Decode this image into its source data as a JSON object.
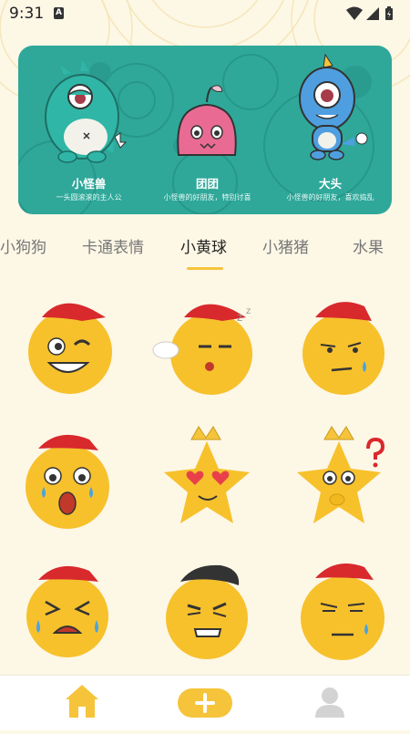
{
  "status_bar": {
    "time": "9:31",
    "notification_badge": "A",
    "icons": [
      "wifi-icon",
      "signal-icon",
      "battery-icon"
    ]
  },
  "banner": {
    "characters": [
      {
        "name": "小怪兽",
        "description": "一头圆滚滚的主人公",
        "color": "#2fb6a6",
        "icon": "green-monster"
      },
      {
        "name": "团团",
        "description": "小怪兽的好朋友，特别讨喜",
        "color": "#e96b93",
        "icon": "pink-blob"
      },
      {
        "name": "大头",
        "description": "小怪兽的好朋友，喜欢捣乱",
        "color": "#4f9fe0",
        "icon": "blue-monster"
      }
    ]
  },
  "tabs": [
    {
      "label": "小狗狗",
      "active": false
    },
    {
      "label": "卡通表情",
      "active": false
    },
    {
      "label": "小黄球",
      "active": true
    },
    {
      "label": "小猪猪",
      "active": false
    },
    {
      "label": "水果",
      "active": false
    }
  ],
  "stickers": [
    {
      "name": "winking-emoji",
      "shape": "ball",
      "hat": "red-cap"
    },
    {
      "name": "sleepy-emoji",
      "shape": "ball",
      "hat": "red-cap",
      "extra": "zzz"
    },
    {
      "name": "worried-emoji",
      "shape": "ball",
      "hat": "red-cap"
    },
    {
      "name": "shocked-crying-emoji",
      "shape": "ball",
      "hat": "red-cap"
    },
    {
      "name": "heart-eyes-star",
      "shape": "star",
      "hat": "crown"
    },
    {
      "name": "thinking-star",
      "shape": "star",
      "hat": "crown",
      "extra": "question-mark"
    },
    {
      "name": "crying-emoji",
      "shape": "ball",
      "hat": "red-cap"
    },
    {
      "name": "smirking-emoji",
      "shape": "ball",
      "hat": "black-cap"
    },
    {
      "name": "unamused-emoji",
      "shape": "ball",
      "hat": "red-cap"
    }
  ],
  "bottom_nav": {
    "items": [
      {
        "name": "home",
        "icon": "home-icon",
        "color": "#f6c43b",
        "active": true
      },
      {
        "name": "add",
        "icon": "plus-icon",
        "color": "#f6c43b",
        "active": false
      },
      {
        "name": "profile",
        "icon": "user-icon",
        "color": "#d3d3d3",
        "active": false
      }
    ]
  },
  "colors": {
    "background": "#fdf7e6",
    "banner": "#2fa89a",
    "accent": "#f6c43b",
    "text_active": "#222222",
    "text_inactive": "#777777"
  }
}
